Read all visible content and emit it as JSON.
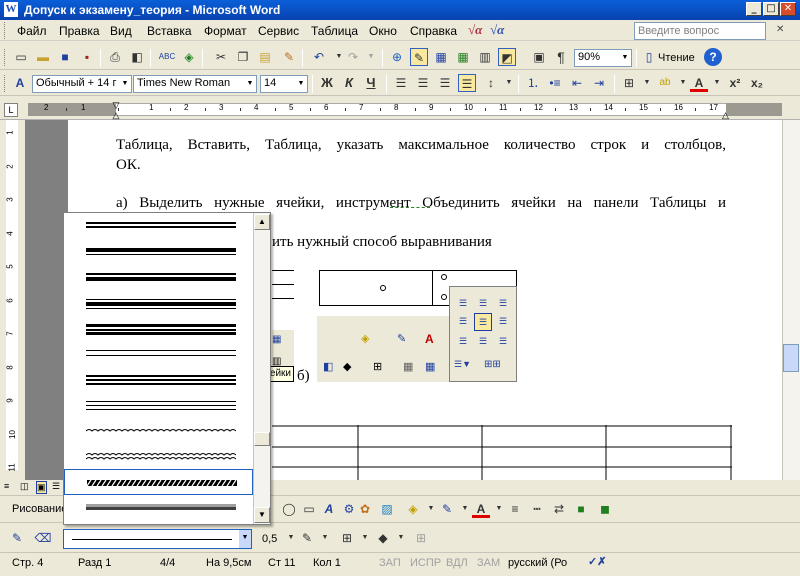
{
  "window": {
    "title": "Допуск к экзамену_теория - Microsoft Word",
    "title_icon": "W",
    "minimize": "_",
    "maximize": "□",
    "close": "✕"
  },
  "menu": {
    "items": [
      "Файл",
      "Правка",
      "Вид",
      "Вставка",
      "Формат",
      "Сервис",
      "Таблица",
      "Окно",
      "Справка"
    ],
    "help_placeholder": "Введите вопрос",
    "close_glyph": "✕"
  },
  "standard_toolbar": {
    "zoom": "90%",
    "reading_label": "Чтение",
    "paragraph_mark": "¶"
  },
  "format_toolbar": {
    "style": "Обычный + 14 г",
    "font": "Times New Roman",
    "size": "14",
    "bold": "Ж",
    "italic": "К",
    "underline": "Ч",
    "superscript": "x²",
    "subscript": "x₂"
  },
  "ruler": {
    "numbers": [
      "2",
      "1",
      "1",
      "2",
      "3",
      "4",
      "5",
      "6",
      "7",
      "8",
      "9",
      "10",
      "11",
      "12",
      "13",
      "14",
      "15",
      "16",
      "17"
    ],
    "vnumbers": [
      "1",
      "2",
      "3",
      "4",
      "5",
      "6",
      "7",
      "8",
      "9",
      "10",
      "11"
    ]
  },
  "document": {
    "lines": [
      "Таблица, Вставить, Таблица, указать максимальное количество строк и столбцов,",
      "ОК.",
      "а) Выделить нужные ячейки, инструмент Объединить ячейки на панели Таблицы и",
      "ить нужный способ выравнивания"
    ],
    "caption_b": "б)",
    "tooltip_fragment": "чейки"
  },
  "line_dropdown": {
    "styles": [
      "double",
      "thick-thin",
      "thin-thick",
      "thin-thick-thin",
      "thick-thin-thick",
      "double-thin",
      "triple",
      "thin-triple",
      "wavy",
      "double-wavy",
      "dash-dot-stroked",
      "3d"
    ],
    "selected_index": 10
  },
  "drawing_toolbar": {
    "label": "Рисование"
  },
  "tables_toolbar": {
    "line_weight": "0,5"
  },
  "status": {
    "page": "Стр. 4",
    "section": "Разд 1",
    "pages": "4/4",
    "at": "На 9,5см",
    "line": "Ст 11",
    "col": "Кол 1",
    "rec": "ЗАП",
    "trk": "ИСПР",
    "ext": "ВДЛ",
    "ovr": "ЗАМ",
    "lang": "русский (Ро"
  }
}
